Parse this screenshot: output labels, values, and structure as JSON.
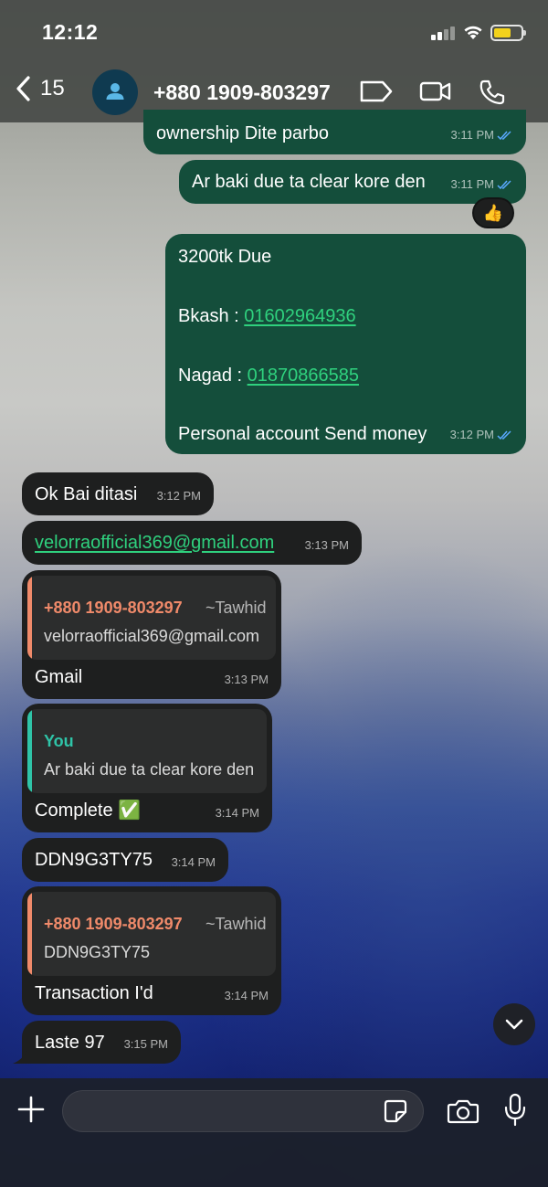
{
  "status_bar": {
    "time": "12:12"
  },
  "header": {
    "back_count": "15",
    "contact_name": "+880 1909-803297"
  },
  "messages": [
    {
      "dir": "out",
      "text": "ownership Dite parbo",
      "time": "3:11 PM"
    },
    {
      "dir": "out",
      "text": "Ar baki due ta clear kore den",
      "time": "3:11 PM",
      "reaction": "👍"
    },
    {
      "dir": "out",
      "lines": {
        "due": "3200tk Due",
        "bkash_label": "Bkash : ",
        "bkash_number": "01602964936",
        "nagad_label": "Nagad : ",
        "nagad_number": "01870866585",
        "note": "Personal account Send money"
      },
      "time": "3:12 PM"
    },
    {
      "dir": "in",
      "text": "Ok Bai ditasi",
      "time": "3:12 PM"
    },
    {
      "dir": "in",
      "text": "velorraofficial369@gmail.com",
      "time": "3:13 PM"
    },
    {
      "dir": "in",
      "quote": {
        "name": "+880 1909-803297",
        "tag": "~Tawhid",
        "text": "velorraofficial369@gmail.com"
      },
      "text": "Gmail",
      "time": "3:13 PM"
    },
    {
      "dir": "in",
      "quote": {
        "name": "You",
        "text": "Ar baki due ta clear kore den"
      },
      "text": "Complete ✅",
      "time": "3:14 PM"
    },
    {
      "dir": "in",
      "text": "DDN9G3TY75",
      "time": "3:14 PM"
    },
    {
      "dir": "in",
      "quote": {
        "name": "+880 1909-803297",
        "tag": "~Tawhid",
        "text": "DDN9G3TY75"
      },
      "text": "Transaction I'd",
      "time": "3:14 PM"
    },
    {
      "dir": "in",
      "text": "Laste 97",
      "time": "3:15 PM"
    }
  ],
  "input": {
    "value": "",
    "placeholder": ""
  },
  "colors": {
    "outgoing_bubble": "#144e3b",
    "incoming_bubble": "#1e1f1f",
    "link": "#2fd17e",
    "quote_contact": "#f08a6a",
    "quote_you": "#2fc4a8",
    "read_checks": "#5aa9ff"
  },
  "icons": [
    "back-chevron-icon",
    "contact-avatar-icon",
    "label-tag-icon",
    "video-call-icon",
    "phone-icon",
    "read-checks-icon",
    "thumbs-up-icon",
    "chevron-down-icon",
    "plus-icon",
    "sticker-icon",
    "camera-icon",
    "microphone-icon"
  ]
}
